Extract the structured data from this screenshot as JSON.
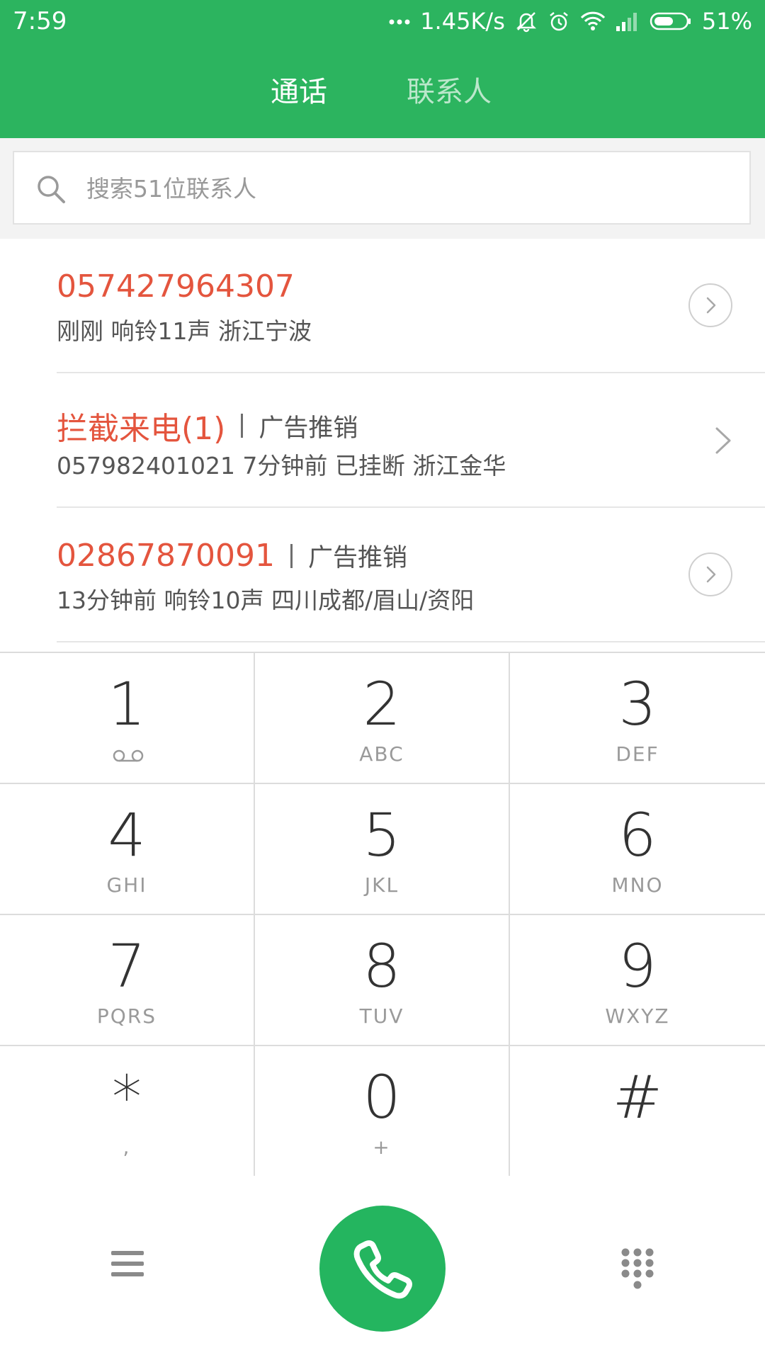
{
  "status_bar": {
    "time": "7:59",
    "network_speed": "1.45K/s",
    "battery": "51%",
    "icons": [
      "more-dots-icon",
      "mute-bell-icon",
      "alarm-icon",
      "wifi-icon",
      "signal-icon",
      "battery-icon"
    ]
  },
  "tabs": [
    {
      "label": "通话",
      "active": true
    },
    {
      "label": "联系人",
      "active": false
    }
  ],
  "search": {
    "placeholder": "搜索51位联系人"
  },
  "calls": [
    {
      "number": "057427964307",
      "tag": "",
      "detail": "刚刚 响铃11声  浙江宁波",
      "action": "detail-circle"
    },
    {
      "number": "拦截来电(1)",
      "tag": "广告推销",
      "detail": "057982401021  7分钟前 已挂断  浙江金华",
      "action": "arrow"
    },
    {
      "number": "02867870091",
      "tag": "广告推销",
      "detail": "13分钟前 响铃10声  四川成都/眉山/资阳",
      "action": "detail-circle"
    }
  ],
  "dialpad": [
    {
      "digit": "1",
      "letters": ""
    },
    {
      "digit": "2",
      "letters": "ABC"
    },
    {
      "digit": "3",
      "letters": "DEF"
    },
    {
      "digit": "4",
      "letters": "GHI"
    },
    {
      "digit": "5",
      "letters": "JKL"
    },
    {
      "digit": "6",
      "letters": "MNO"
    },
    {
      "digit": "7",
      "letters": "PQRS"
    },
    {
      "digit": "8",
      "letters": "TUV"
    },
    {
      "digit": "9",
      "letters": "WXYZ"
    },
    {
      "digit": "*",
      "letters": ","
    },
    {
      "digit": "0",
      "letters": "+"
    },
    {
      "digit": "#",
      "letters": ""
    }
  ],
  "colors": {
    "header": "#2cb45f",
    "call_button": "#24b55f",
    "missed_number": "#e4553e"
  }
}
